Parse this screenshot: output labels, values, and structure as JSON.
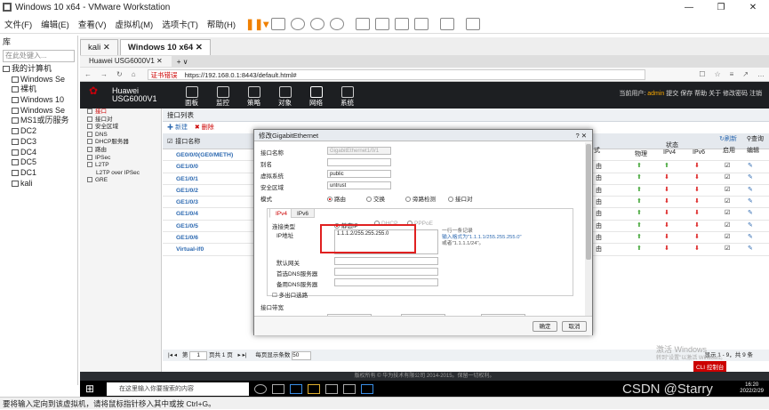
{
  "window": {
    "title": "Windows 10 x64 - VMware Workstation"
  },
  "menu": [
    "文件(F)",
    "编辑(E)",
    "查看(V)",
    "虚拟机(M)",
    "选项卡(T)",
    "帮助(H)"
  ],
  "library": {
    "header": "库",
    "search_placeholder": "在此处键入...",
    "items": [
      "我的计算机",
      "Windows Se",
      "裸机",
      "Windows 10",
      "Windows Se",
      "MS1或历服务",
      "DC2",
      "DC3",
      "DC4",
      "DC5",
      "DC1",
      "kali"
    ]
  },
  "vm_tabs": [
    "kali",
    "Windows 10 x64"
  ],
  "browser": {
    "tab_title": "Huawei USG6000V1",
    "cert_warning": "证书错误",
    "url": "https://192.168.0.1:8443/default.html#"
  },
  "huawei": {
    "brand": "Huawei",
    "model": "USG6000V1",
    "nav": [
      "面板",
      "监控",
      "策略",
      "对象",
      "网络",
      "系统"
    ],
    "user_prefix": "当前用户:",
    "user": "admin",
    "user_actions": "提交 保存 帮助 关于 修改密码 注销"
  },
  "leftnav": [
    "接口",
    "接口对",
    "安全区域",
    "DNS",
    "DHCP服务器",
    "路由",
    "IPSec",
    "L2TP",
    "L2TP over IPSec",
    "GRE"
  ],
  "interface_list": {
    "title": "接口列表",
    "add": "新建",
    "delete": "删除",
    "columns": {
      "name": "接口名称",
      "status": "状态",
      "physical": "物理",
      "ipv4": "IPv4",
      "ipv6": "IPv6",
      "enable": "启用",
      "edit": "编辑",
      "other": "式"
    },
    "refresh": "刷新",
    "search": "查询",
    "rows": [
      "GE0/0/0(GE0/METH)",
      "GE1/0/0",
      "GE1/0/1",
      "GE1/0/2",
      "GE1/0/3",
      "GE1/0/4",
      "GE1/0/5",
      "GE1/0/6",
      "Virtual-if0"
    ],
    "mode_cell": "由"
  },
  "modal": {
    "title": "修改GigabitEthernet",
    "fields": {
      "iface_name_label": "接口名称",
      "iface_name_value": "GigabitEthernet1/0/1",
      "alias_label": "别名",
      "vsys_label": "虚拟系统",
      "vsys_value": "public",
      "zone_label": "安全区域",
      "zone_value": "untrust",
      "mode_label": "模式",
      "mode_options": [
        "路由",
        "交换",
        "旁路检测",
        "接口对"
      ]
    },
    "tabs": [
      "IPv4",
      "IPv6"
    ],
    "conn_type_label": "连接类型",
    "conn_types": [
      "静态IP",
      "DHCP",
      "PPPoE"
    ],
    "ip_label": "IP地址",
    "ip_value": "1.1.1.2/255.255.255.0",
    "ip_hint_1": "一行一条记录",
    "ip_hint_2": "输入格式为\"1.1.1.1/255.255.255.0\"",
    "ip_hint_3": "或者\"1.1.1.1/24\"。",
    "gateway_label": "默认网关",
    "dns1_label": "首选DNS服务器",
    "dns2_label": "备用DNS服务器",
    "multi_exit": "多出口选路",
    "management_label": "接口带宽",
    "ok": "确定",
    "cancel": "取消"
  },
  "pager": {
    "page_label": "第",
    "page": "1",
    "total_pages": "页共 1 页",
    "per_page_label": "每页显示条数",
    "per_page": "50",
    "summary": "显示 1 - 9，共 9 条"
  },
  "copyright": "版权所有 © 华为技术有限公司 2014-2015。保留一切权利。",
  "taskbar": {
    "search": "在这里输入你要搜索的内容",
    "time": "16:20",
    "date": "2022/2/29"
  },
  "activate": [
    "激活 Windows",
    "转到\"设置\"以激活 Windows。"
  ],
  "ck_badge": "CLI 控制台",
  "watermark": "CSDN @Starry",
  "status": "要将输入定向到该虚拟机，请将鼠标指针移入其中或按 Ctrl+G。",
  "colors": {
    "huawei_red": "#c7000b",
    "highlight": "#e02020",
    "link_blue": "#2e6ab1"
  }
}
